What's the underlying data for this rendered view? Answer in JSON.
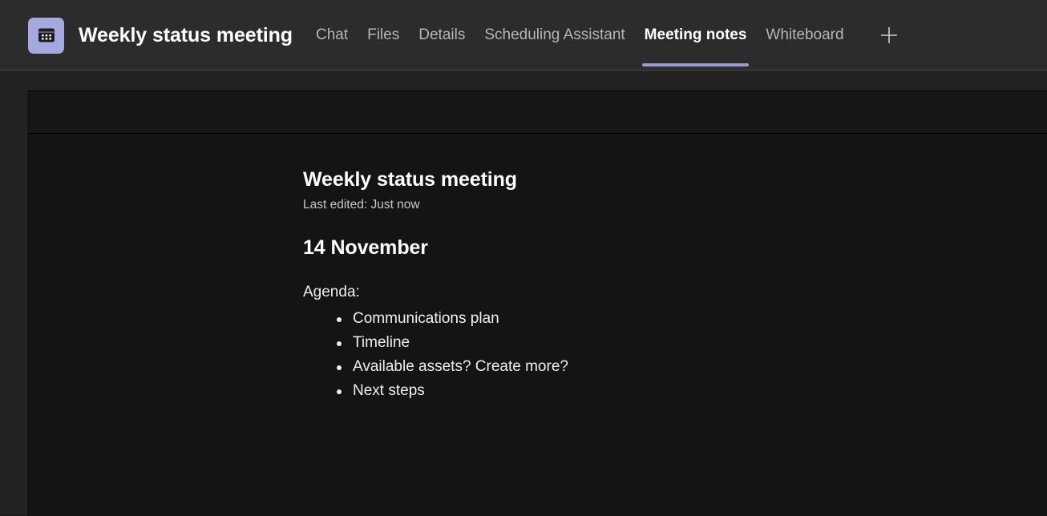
{
  "header": {
    "app_icon": "calendar-meeting-icon",
    "meeting_title": "Weekly status meeting",
    "add_tab_icon": "plus-icon",
    "accent_color": "#9a9ad4",
    "icon_background": "#a6a8e0",
    "tabs": [
      {
        "label": "Chat",
        "active": false
      },
      {
        "label": "Files",
        "active": false
      },
      {
        "label": "Details",
        "active": false
      },
      {
        "label": "Scheduling Assistant",
        "active": false
      },
      {
        "label": "Meeting notes",
        "active": true
      },
      {
        "label": "Whiteboard",
        "active": false
      }
    ]
  },
  "note": {
    "title": "Weekly status meeting",
    "last_edited": "Last edited: Just now",
    "date_heading": "14 November",
    "agenda_label": "Agenda:",
    "agenda_items": [
      "Communications plan",
      "Timeline",
      "Available assets? Create more?",
      "Next steps"
    ]
  }
}
